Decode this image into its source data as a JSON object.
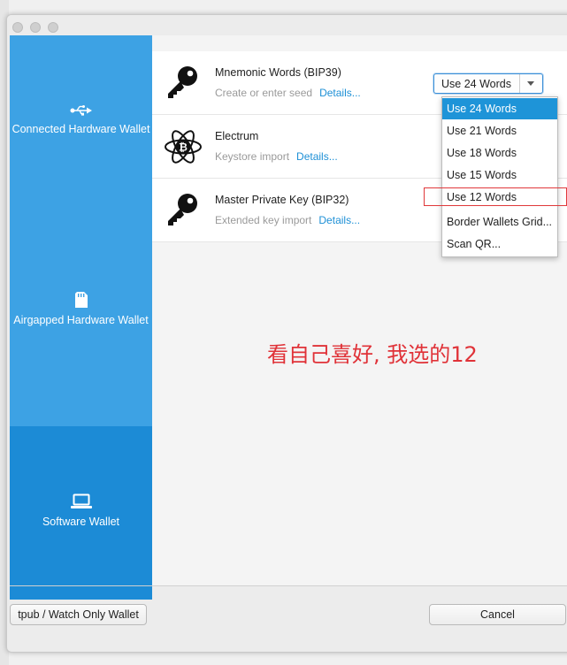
{
  "sidebar": {
    "items": [
      {
        "label": "Connected Hardware Wallet",
        "icon": "usb-icon",
        "active": false
      },
      {
        "label": "Airgapped Hardware Wallet",
        "icon": "sd-card-icon",
        "active": false
      },
      {
        "label": "Software Wallet",
        "icon": "laptop-icon",
        "active": true
      }
    ]
  },
  "rows": [
    {
      "title": "Mnemonic Words (BIP39)",
      "subtitle": "Create or enter seed",
      "link": "Details...",
      "icon": "key-icon"
    },
    {
      "title": "Electrum",
      "subtitle": "Keystore import",
      "link": "Details...",
      "icon": "electrum-logo-icon"
    },
    {
      "title": "Master Private Key (BIP32)",
      "subtitle": "Extended key import",
      "link": "Details...",
      "icon": "key-icon"
    }
  ],
  "word_combo": {
    "value": "Use 24 Words",
    "options": [
      "Use 24 Words",
      "Use 21 Words",
      "Use 18 Words",
      "Use 15 Words",
      "Use 12 Words",
      "Border Wallets Grid...",
      "Scan QR..."
    ],
    "selected_index": 0,
    "highlighted_index": 4
  },
  "annotation": "看自己喜好, 我选的12",
  "buttons": {
    "tpub": "tpub / Watch Only Wallet",
    "cancel": "Cancel"
  },
  "colors": {
    "sidebar": "#3da2e4",
    "sidebar_active": "#1c8bd6",
    "link": "#1e90d6",
    "selection": "#1e94d8",
    "annotation": "#e03238"
  }
}
